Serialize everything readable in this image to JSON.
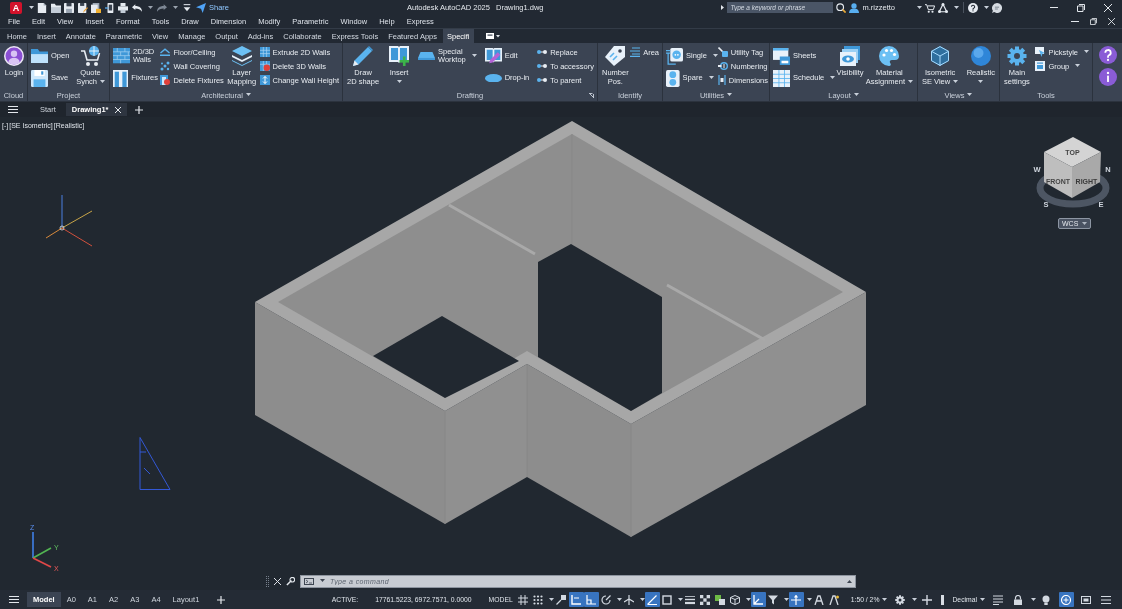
{
  "title_bar": {
    "app_logo": "A",
    "share": "Share",
    "title": "Autodesk AutoCAD 2025",
    "document": "Drawing1.dwg",
    "search": {
      "placeholder": "Type a keyword or phrase"
    },
    "user": "m.rizzetto"
  },
  "menu_bar": [
    "File",
    "Edit",
    "View",
    "Insert",
    "Format",
    "Tools",
    "Draw",
    "Dimension",
    "Modify",
    "Parametric",
    "Window",
    "Help",
    "Express"
  ],
  "ribbon_tabs": [
    {
      "label": "Home",
      "selected": false
    },
    {
      "label": "Insert",
      "selected": false
    },
    {
      "label": "Annotate",
      "selected": false
    },
    {
      "label": "Parametric",
      "selected": false
    },
    {
      "label": "View",
      "selected": false
    },
    {
      "label": "Manage",
      "selected": false
    },
    {
      "label": "Output",
      "selected": false
    },
    {
      "label": "Add-ins",
      "selected": false
    },
    {
      "label": "Collaborate",
      "selected": false
    },
    {
      "label": "Express Tools",
      "selected": false
    },
    {
      "label": "Featured Apps",
      "selected": false
    },
    {
      "label": "Specifi",
      "selected": true
    }
  ],
  "ribbon_panels": [
    {
      "title": "Cloud",
      "menu": false,
      "launcher": false,
      "columns": [
        {
          "kind": "large",
          "tools": [
            {
              "label": "Login",
              "dropdown": false
            }
          ]
        }
      ]
    },
    {
      "title": "Project",
      "menu": false,
      "launcher": false,
      "columns": [
        {
          "kind": "medium",
          "tools": [
            {
              "label": "Open",
              "dropdown": false
            },
            {
              "label": "Save",
              "dropdown": false
            }
          ]
        },
        {
          "kind": "large",
          "tools": [
            {
              "label": "Quote\nSynch",
              "dropdown": true
            }
          ]
        }
      ]
    },
    {
      "title": "Architectural",
      "menu": true,
      "launcher": false,
      "columns": [
        {
          "kind": "medium",
          "tools": [
            {
              "label": "2D/3D\nWalls",
              "dropdown": false
            },
            {
              "label": "Fixtures",
              "dropdown": false
            }
          ]
        },
        {
          "kind": "small",
          "tools": [
            {
              "label": "Floor/Ceiling",
              "dropdown": false
            },
            {
              "label": "Wall Covering",
              "dropdown": false
            },
            {
              "label": "Delete Fixtures",
              "dropdown": false
            }
          ]
        },
        {
          "kind": "large",
          "tools": [
            {
              "label": "Layer\nMapping",
              "dropdown": false
            }
          ]
        },
        {
          "kind": "small",
          "tools": [
            {
              "label": "Extrude 2D Walls",
              "dropdown": false
            },
            {
              "label": "Delete 3D Walls",
              "dropdown": false
            },
            {
              "label": "Change Wall Height",
              "dropdown": false
            }
          ]
        }
      ]
    },
    {
      "title": "Drafting",
      "menu": false,
      "launcher": true,
      "columns": [
        {
          "kind": "large",
          "tools": [
            {
              "label": "Draw\n2D shape",
              "dropdown": false
            }
          ]
        },
        {
          "kind": "large",
          "tools": [
            {
              "label": "Insert",
              "dropdown": true
            }
          ]
        },
        {
          "kind": "medium",
          "tools": [
            {
              "label": "Special\nWorktop",
              "dropdown": true
            }
          ]
        },
        {
          "kind": "medium",
          "tools": [
            {
              "label": "Edit",
              "dropdown": false
            },
            {
              "label": "Drop-in",
              "dropdown": false
            }
          ]
        },
        {
          "kind": "small",
          "tools": [
            {
              "label": "Replace",
              "dropdown": false
            },
            {
              "label": "To accessory",
              "dropdown": false
            },
            {
              "label": "To parent",
              "dropdown": false
            }
          ]
        }
      ]
    },
    {
      "title": "Identify",
      "menu": false,
      "launcher": false,
      "columns": [
        {
          "kind": "large",
          "tools": [
            {
              "label": "Number\nPos.",
              "dropdown": false
            }
          ]
        },
        {
          "kind": "small",
          "tools": [
            {
              "label": "Area",
              "dropdown": false
            }
          ]
        }
      ]
    },
    {
      "title": "Utilities",
      "menu": true,
      "launcher": false,
      "columns": [
        {
          "kind": "medium",
          "tools": [
            {
              "label": "Single",
              "dropdown": true
            },
            {
              "label": "Spare",
              "dropdown": true
            }
          ]
        },
        {
          "kind": "small",
          "tools": [
            {
              "label": "Utility Tag",
              "dropdown": false
            },
            {
              "label": "Numbering",
              "dropdown": false
            },
            {
              "label": "Dimensions",
              "dropdown": false
            }
          ]
        }
      ]
    },
    {
      "title": "Layout",
      "menu": true,
      "launcher": false,
      "columns": [
        {
          "kind": "medium",
          "tools": [
            {
              "label": "Sheets",
              "dropdown": false
            },
            {
              "label": "Schedule",
              "dropdown": true
            }
          ]
        },
        {
          "kind": "large",
          "tools": [
            {
              "label": "Visibility",
              "dropdown": false
            }
          ]
        },
        {
          "kind": "large",
          "tools": [
            {
              "label": "Material\nAssignment",
              "dropdown": true
            }
          ]
        }
      ]
    },
    {
      "title": "Views",
      "menu": true,
      "launcher": false,
      "columns": [
        {
          "kind": "large",
          "tools": [
            {
              "label": "Isometric\nSE View",
              "dropdown": true
            }
          ]
        },
        {
          "kind": "large",
          "tools": [
            {
              "label": "Realistic",
              "dropdown": true
            }
          ]
        }
      ]
    },
    {
      "title": "Tools",
      "menu": false,
      "launcher": false,
      "columns": [
        {
          "kind": "large",
          "tools": [
            {
              "label": "Main\nsettings",
              "dropdown": false
            }
          ]
        },
        {
          "kind": "small",
          "tools": [
            {
              "label": "Pickstyle",
              "dropdown": true
            },
            {
              "label": "Group",
              "dropdown": true
            }
          ]
        }
      ]
    }
  ],
  "file_tabs": [
    {
      "label": "Start",
      "selected": false,
      "closable": false
    },
    {
      "label": "Drawing1*",
      "selected": true,
      "closable": true
    }
  ],
  "viewport": {
    "controls": [
      "[-]",
      "[SE Isometric]",
      "[Realistic]"
    ],
    "view_cube": {
      "faces": [
        "TOP",
        "FRONT",
        "RIGHT"
      ],
      "compass": [
        "W",
        "N",
        "S",
        "E"
      ],
      "coordinate_system": "WCS"
    },
    "ucs_axes": [
      "Z",
      "Y",
      "X"
    ]
  },
  "command_line": {
    "placeholder": "Type a command"
  },
  "status_bar": {
    "layout_tabs": [
      {
        "label": "Model",
        "selected": true
      },
      {
        "label": "A0",
        "selected": false
      },
      {
        "label": "A1",
        "selected": false
      },
      {
        "label": "A2",
        "selected": false
      },
      {
        "label": "A3",
        "selected": false
      },
      {
        "label": "A4",
        "selected": false
      },
      {
        "label": "Layout1",
        "selected": false
      }
    ],
    "active_label": "ACTIVE:",
    "coordinates": "17761.5223, 6972.7571, 0.0000",
    "space": "MODEL",
    "toggles": [
      {
        "on": false,
        "menu": false
      },
      {
        "on": false,
        "menu": true
      },
      {
        "on": false,
        "menu": false
      },
      {
        "on": true,
        "menu": false
      },
      {
        "on": true,
        "menu": false
      },
      {
        "on": false,
        "menu": true
      },
      {
        "on": false,
        "menu": true
      },
      {
        "on": true,
        "menu": false
      },
      {
        "on": false,
        "menu": true
      },
      {
        "on": false,
        "menu": false
      },
      {
        "on": false,
        "menu": false
      },
      {
        "on": false,
        "menu": false
      },
      {
        "on": false,
        "menu": true
      },
      {
        "on": true,
        "menu": false
      },
      {
        "on": false,
        "menu": true
      },
      {
        "on": true,
        "menu": true
      },
      {
        "on": false,
        "menu": false
      },
      {
        "on": false,
        "menu": false
      }
    ],
    "annotation_scale": "1:50 / 2%",
    "workspace_tools": [
      {
        "on": false,
        "menu": true
      },
      {
        "on": false,
        "menu": false
      }
    ],
    "units": "Decimal",
    "display_tools": [
      {
        "on": false,
        "menu": false
      },
      {
        "on": false,
        "menu": true
      },
      {
        "on": false,
        "menu": false
      },
      {
        "on": true,
        "menu": false
      },
      {
        "on": false,
        "menu": false
      },
      {
        "on": false,
        "menu": false
      }
    ]
  }
}
